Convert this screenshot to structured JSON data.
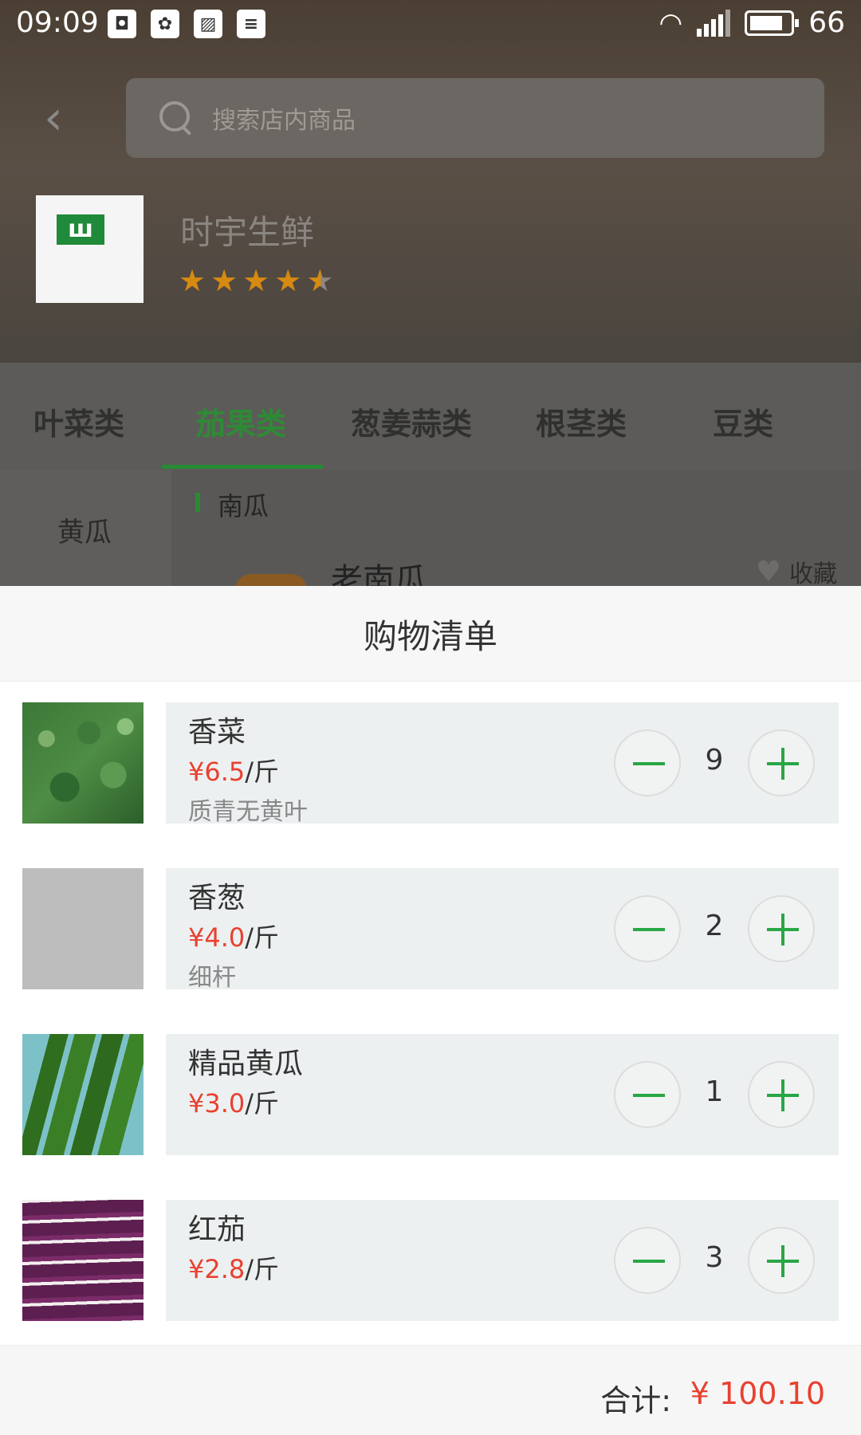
{
  "status_bar": {
    "time": "09:09",
    "battery": "66"
  },
  "search": {
    "placeholder": "搜索店内商品"
  },
  "shop": {
    "name": "时宇生鲜",
    "rating": 4.5
  },
  "categories": [
    {
      "label": "叶菜类",
      "active": false
    },
    {
      "label": "茄果类",
      "active": true
    },
    {
      "label": "葱姜蒜类",
      "active": false
    },
    {
      "label": "根茎类",
      "active": false
    },
    {
      "label": "豆类",
      "active": false
    }
  ],
  "sidebar": {
    "item": "黄瓜"
  },
  "content": {
    "section_title": "南瓜",
    "product_name": "老南瓜",
    "favorite_label": "收藏"
  },
  "cart": {
    "title": "购物清单",
    "currency": "¥",
    "unit": "/斤",
    "items": [
      {
        "name": "香菜",
        "price": "6.5",
        "desc": "质青无黄叶",
        "qty": "9"
      },
      {
        "name": "香葱",
        "price": "4.0",
        "desc": "细杆",
        "qty": "2"
      },
      {
        "name": "精品黄瓜",
        "price": "3.0",
        "desc": "",
        "qty": "1"
      },
      {
        "name": "红茄",
        "price": "2.8",
        "desc": "",
        "qty": "3"
      }
    ],
    "total_label": "合计:",
    "total_value": "¥ 100.10"
  },
  "colors": {
    "accent_green": "#28a745",
    "price_red": "#e8412f"
  }
}
